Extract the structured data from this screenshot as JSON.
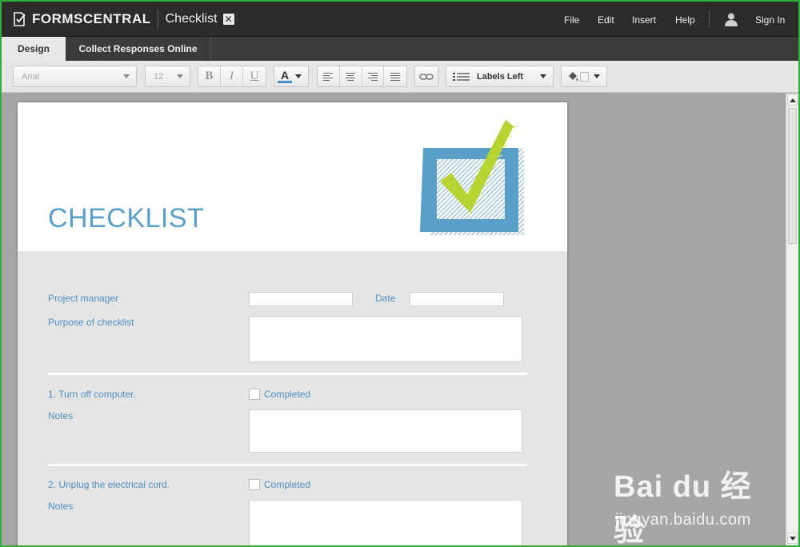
{
  "app": {
    "brand": "FORMSCENTRAL",
    "document_title": "Checklist"
  },
  "menu": {
    "file": "File",
    "edit": "Edit",
    "insert": "Insert",
    "help": "Help",
    "sign_in": "Sign In"
  },
  "tabs": [
    {
      "label": "Design",
      "active": true
    },
    {
      "label": "Collect Responses Online",
      "active": false
    }
  ],
  "toolbar": {
    "font_family": "Arial",
    "font_size": "12",
    "bold": "B",
    "italic": "I",
    "underline": "U",
    "text_color_glyph": "A",
    "labels_position": "Labels Left"
  },
  "form": {
    "title": "CHECKLIST",
    "fields": {
      "project_manager_label": "Project manager",
      "date_label": "Date",
      "purpose_label": "Purpose of checklist"
    },
    "items": [
      {
        "label": "1. Turn off computer.",
        "checkbox_label": "Completed",
        "notes_label": "Notes"
      },
      {
        "label": "2. Unplug the electrical cord.",
        "checkbox_label": "Completed",
        "notes_label": "Notes"
      }
    ]
  },
  "watermark": {
    "main": "Bai du 经验",
    "sub": "jingyan.baidu.com"
  },
  "colors": {
    "accent_blue": "#5a9fc8",
    "check_green": "#b8d432",
    "topbar": "#2b2b2b",
    "border_green": "#2bb03c"
  }
}
